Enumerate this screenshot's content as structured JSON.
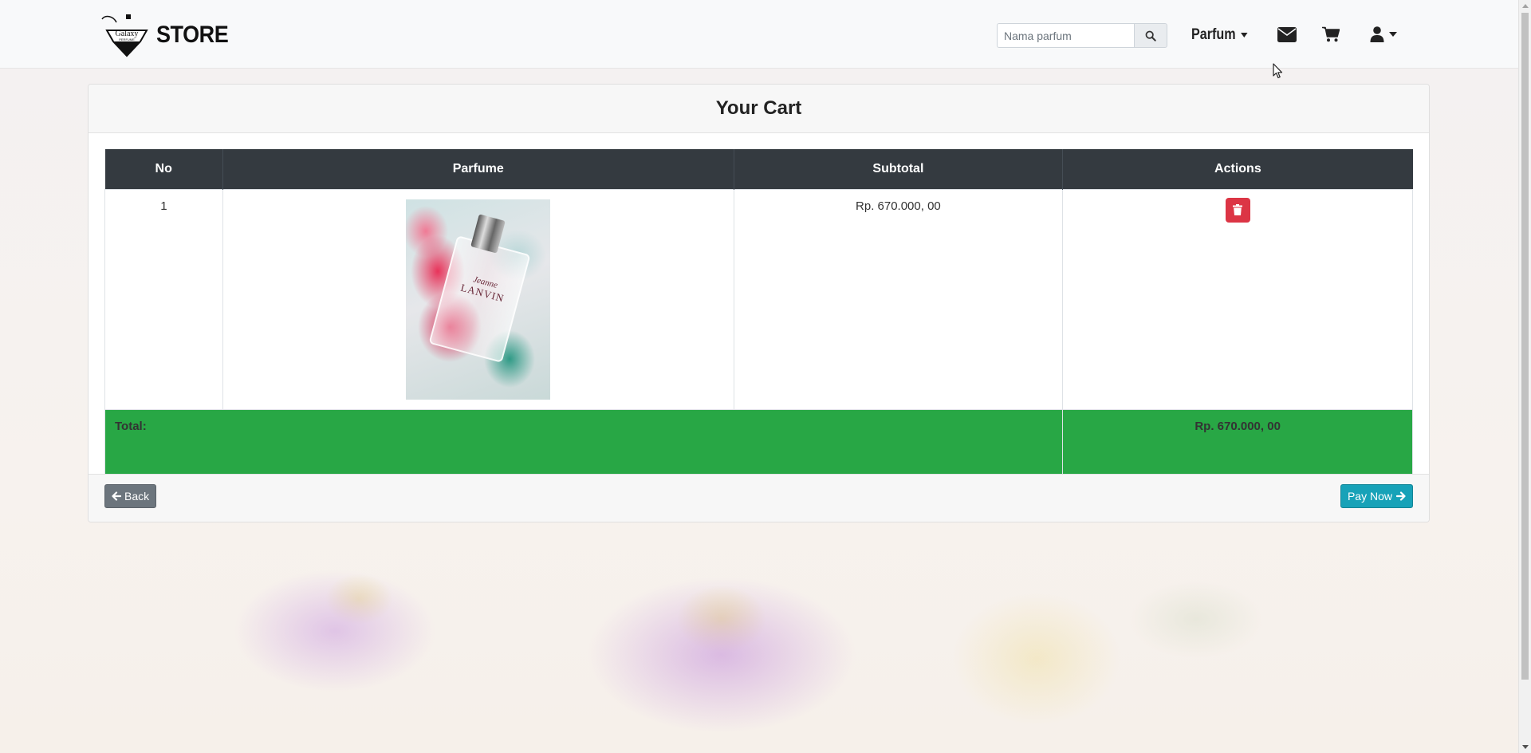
{
  "navbar": {
    "logo_text": "Galaxy",
    "logo_subtext": "PERFUME",
    "brand": "STORE",
    "search": {
      "placeholder": "Nama parfum",
      "value": ""
    },
    "dropdown_label": "Parfum",
    "icons": [
      "search-icon",
      "envelope-icon",
      "cart-icon",
      "user-icon"
    ]
  },
  "cart": {
    "title": "Your Cart",
    "columns": [
      "No",
      "Parfume",
      "Subtotal",
      "Actions"
    ],
    "items": [
      {
        "no": "1",
        "image_label_line1": "Jeanne",
        "image_label_line2": "LANVIN",
        "subtotal": "Rp. 670.000, 00"
      }
    ],
    "total_label": "Total:",
    "total_value": "Rp. 670.000, 00"
  },
  "footer": {
    "back_label": "Back",
    "pay_label": "Pay Now"
  },
  "colors": {
    "table_header": "#343a40",
    "total_row": "#28a745",
    "delete": "#dc3545",
    "pay": "#17a2b8",
    "back": "#6c757d"
  }
}
